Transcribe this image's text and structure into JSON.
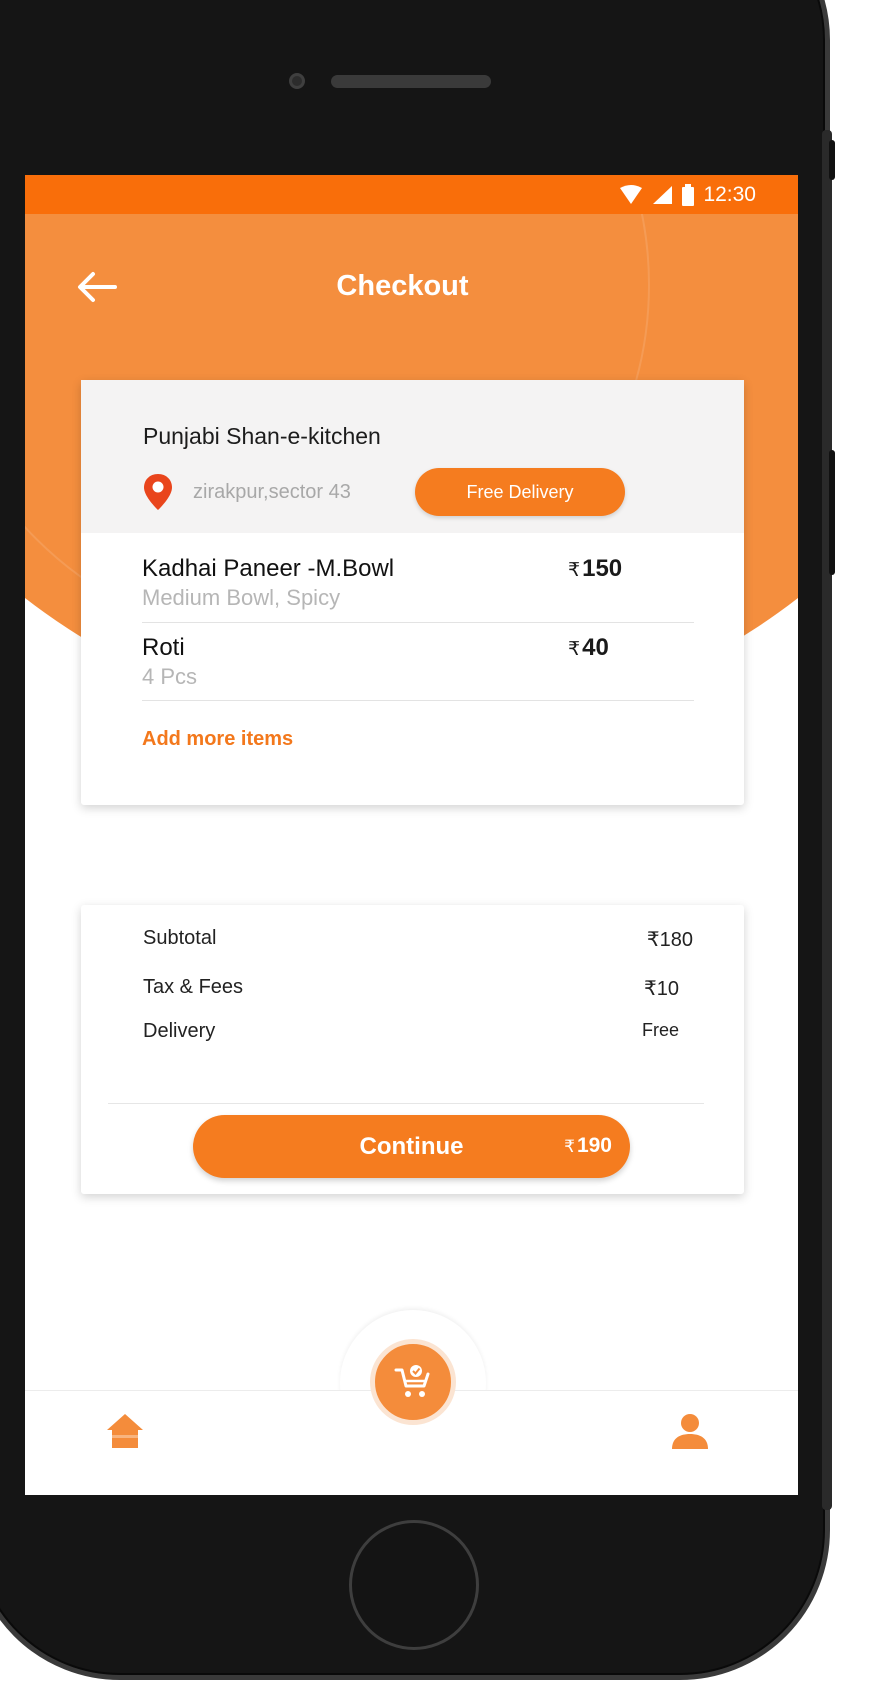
{
  "status_bar": {
    "time": "12:30",
    "icons": [
      "wifi-icon",
      "signal-icon",
      "battery-icon"
    ]
  },
  "header": {
    "title": "Checkout",
    "back_icon": "back-arrow-icon"
  },
  "restaurant": {
    "name": "Punjabi Shan-e-kitchen",
    "location": "zirakpur,sector 43",
    "badge": "Free Delivery"
  },
  "items": [
    {
      "name": "Kadhai  Paneer  -M.Bowl",
      "desc": "Medium Bowl, Spicy",
      "currency": "₹",
      "price": "150"
    },
    {
      "name": "Roti",
      "desc": "4 Pcs",
      "currency": "₹",
      "price": "40"
    }
  ],
  "add_more_label": "Add more items",
  "summary": {
    "subtotal_label": "Subtotal",
    "subtotal_value": "₹180",
    "tax_label": "Tax & Fees",
    "tax_value": "₹10",
    "delivery_label": "Delivery",
    "delivery_value": "Free"
  },
  "continue_button": {
    "label": "Continue",
    "currency": "₹",
    "total": "190"
  },
  "bottom_nav": {
    "left_icon": "home-icon",
    "center_icon": "cart-check-icon",
    "right_icon": "profile-icon"
  },
  "colors": {
    "accent": "#f57c1f",
    "status_bar": "#f96e0a",
    "header": "#f48e3e"
  }
}
